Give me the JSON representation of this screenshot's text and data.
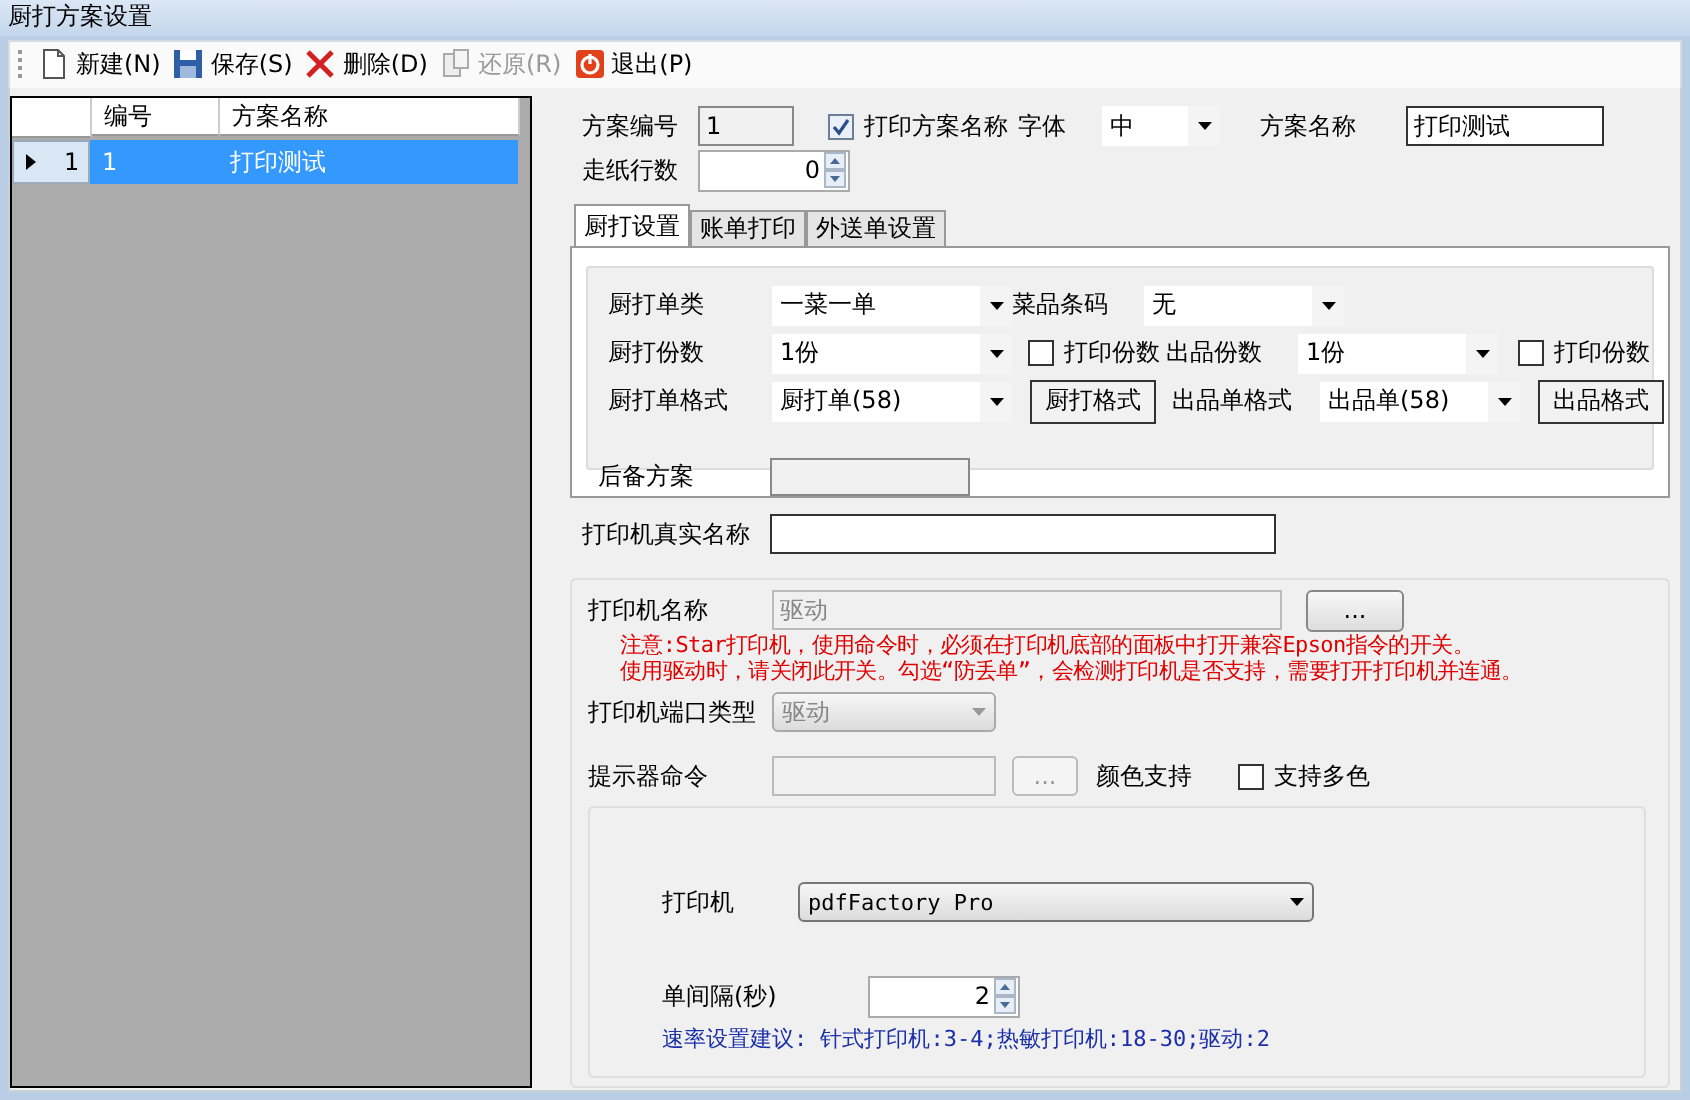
{
  "window": {
    "title": "厨打方案设置"
  },
  "toolbar": [
    {
      "kind": "new",
      "label": "新建(N)",
      "disabled": false
    },
    {
      "kind": "save",
      "label": "保存(S)",
      "disabled": false
    },
    {
      "kind": "delete",
      "label": "删除(D)",
      "disabled": false
    },
    {
      "kind": "restore",
      "label": "还原(R)",
      "disabled": true
    },
    {
      "kind": "exit",
      "label": "退出(P)",
      "disabled": false
    }
  ],
  "grid": {
    "columns": [
      "编号",
      "方案名称"
    ],
    "rows": [
      {
        "row_header": "1",
        "cells": [
          "1",
          "打印测试"
        ],
        "selected": true
      }
    ]
  },
  "form": {
    "scheme_no": {
      "label": "方案编号",
      "value": "1"
    },
    "print_name": {
      "label": "打印方案名称",
      "checked": true
    },
    "font": {
      "label": "字体",
      "value": "中"
    },
    "scheme_name": {
      "label": "方案名称",
      "value": "打印测试"
    },
    "feed_lines": {
      "label": "走纸行数",
      "value": "0"
    }
  },
  "tabs": [
    {
      "label": "厨打设置",
      "selected": true
    },
    {
      "label": "账单打印",
      "selected": false
    },
    {
      "label": "外送单设置",
      "selected": false
    }
  ],
  "kitchen": {
    "type": {
      "label": "厨打单类",
      "value": "一菜一单"
    },
    "barcode": {
      "label": "菜品条码",
      "value": "无"
    },
    "copies": {
      "label": "厨打份数",
      "value": "1份"
    },
    "print_copies": {
      "label": "打印份数",
      "checked": false
    },
    "out_copies": {
      "label": "出品份数",
      "value": "1份"
    },
    "out_print_copies": {
      "label": "打印份数",
      "checked": false
    },
    "format": {
      "label": "厨打单格式",
      "value": "厨打单(58)"
    },
    "format_button": "厨打格式",
    "out_format": {
      "label": "出品单格式",
      "value": "出品单(58)"
    },
    "out_format_button": "出品格式",
    "backup": {
      "label": "后备方案"
    }
  },
  "real_name": {
    "label": "打印机真实名称"
  },
  "printer_name": {
    "label": "打印机名称",
    "value": "驱动",
    "disabled": true,
    "button": "..."
  },
  "notice": [
    "注意:Star打印机，使用命令时，必须在打印机底部的面板中打开兼容Epson指令的开关。",
    "使用驱动时，请关闭此开关。勾选“防丢单”，会检测打印机是否支持，需要打开打印机并连通。"
  ],
  "port_type": {
    "label": "打印机端口类型",
    "value": "驱动",
    "disabled": true
  },
  "prompter": {
    "label": "提示器命令",
    "disabled": true,
    "button": "..."
  },
  "color_support": {
    "label": "颜色支持"
  },
  "multi_color": {
    "label": "支持多色",
    "checked": false
  },
  "printer": {
    "label": "打印机",
    "value": "pdfFactory Pro"
  },
  "interval": {
    "label": "单间隔(秒)",
    "value": "2"
  },
  "rate_hint": "速率设置建议: 针式打印机:3-4;热敏打印机:18-30;驱动:2"
}
